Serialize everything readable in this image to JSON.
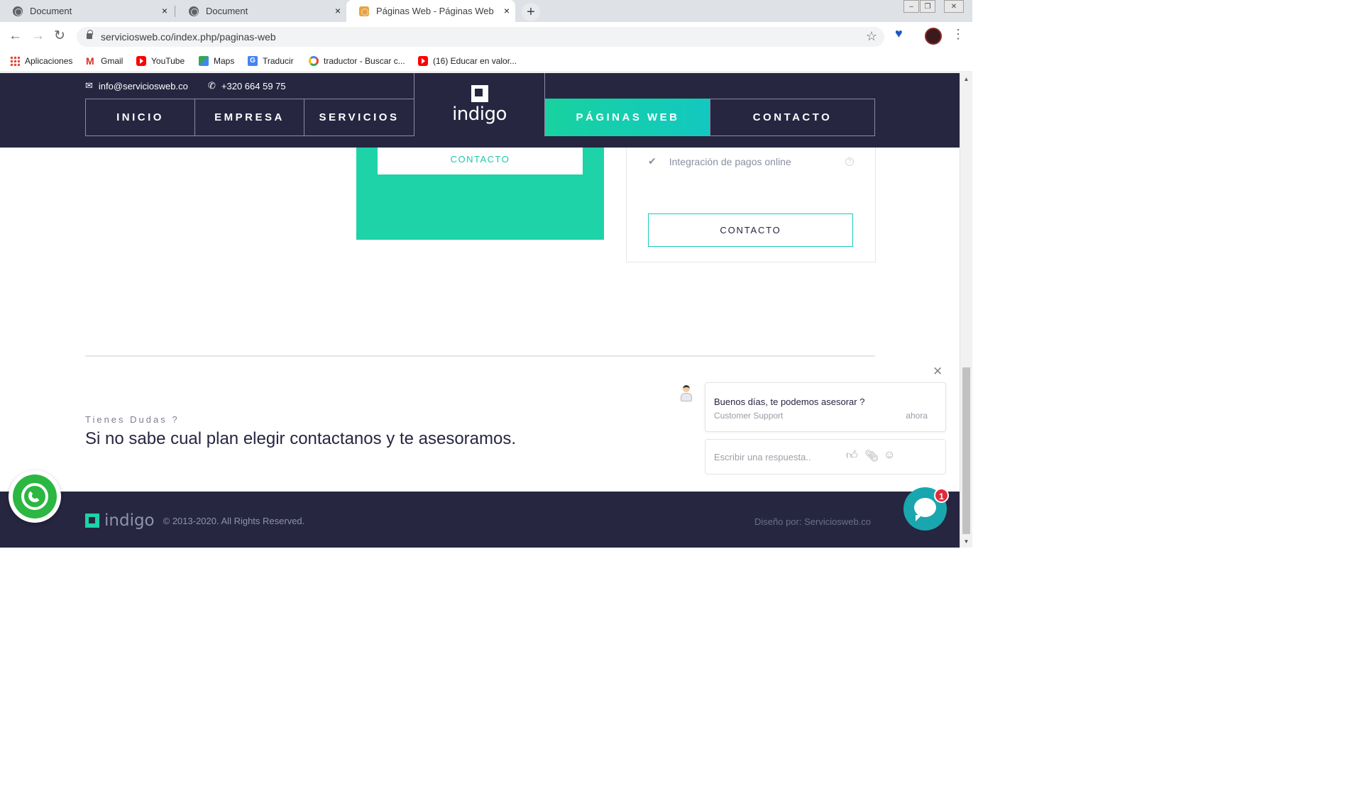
{
  "browser": {
    "tabs": [
      {
        "title": "Document",
        "close": "×"
      },
      {
        "title": "Document",
        "close": "×"
      },
      {
        "title": "Páginas Web - Páginas Web",
        "close": "×"
      }
    ],
    "new_tab": "+",
    "url": "serviciosweb.co/index.php/paginas-web",
    "bookmarks": [
      {
        "label": "Aplicaciones",
        "icon": "apps-grid-icon"
      },
      {
        "label": "Gmail",
        "icon": "gmail-icon"
      },
      {
        "label": "YouTube",
        "icon": "youtube-icon"
      },
      {
        "label": "Maps",
        "icon": "maps-icon"
      },
      {
        "label": "Traducir",
        "icon": "translate-icon"
      },
      {
        "label": "traductor - Buscar c...",
        "icon": "google-icon"
      },
      {
        "label": "(16) Educar en valor...",
        "icon": "youtube-icon"
      }
    ]
  },
  "site": {
    "email": "info@serviciosweb.co",
    "phone": "+320 664 59 75",
    "nav": [
      {
        "label": "INICIO"
      },
      {
        "label": "EMPRESA"
      },
      {
        "label": "SERVICIOS"
      },
      {
        "label": "PÁGINAS WEB",
        "active": true
      },
      {
        "label": "CONTACTO"
      }
    ],
    "logo": "indigo",
    "colors": {
      "navy": "#262641",
      "teal": "#1dd3a7",
      "cyan": "#12c8c0"
    }
  },
  "pricing": {
    "green_card_button": "CONTACTO",
    "white_card_feature": "Integración de pagos online",
    "white_card_button": "CONTACTO"
  },
  "cta": {
    "eyebrow": "Tienes Dudas ?",
    "headline": "Si no sabe cual plan elegir contactanos y te asesoramos."
  },
  "footer": {
    "logo": "indigo",
    "copyright": "© 2013-2020. All Rights Reserved.",
    "credit": "Diseño por: Serviciosweb.co"
  },
  "chat": {
    "message": "Buenos  días, te podemos asesorar ?",
    "sender": "Customer Support",
    "time": "ahora",
    "input_placeholder": "Escribir una respuesta..",
    "badge": "1"
  }
}
